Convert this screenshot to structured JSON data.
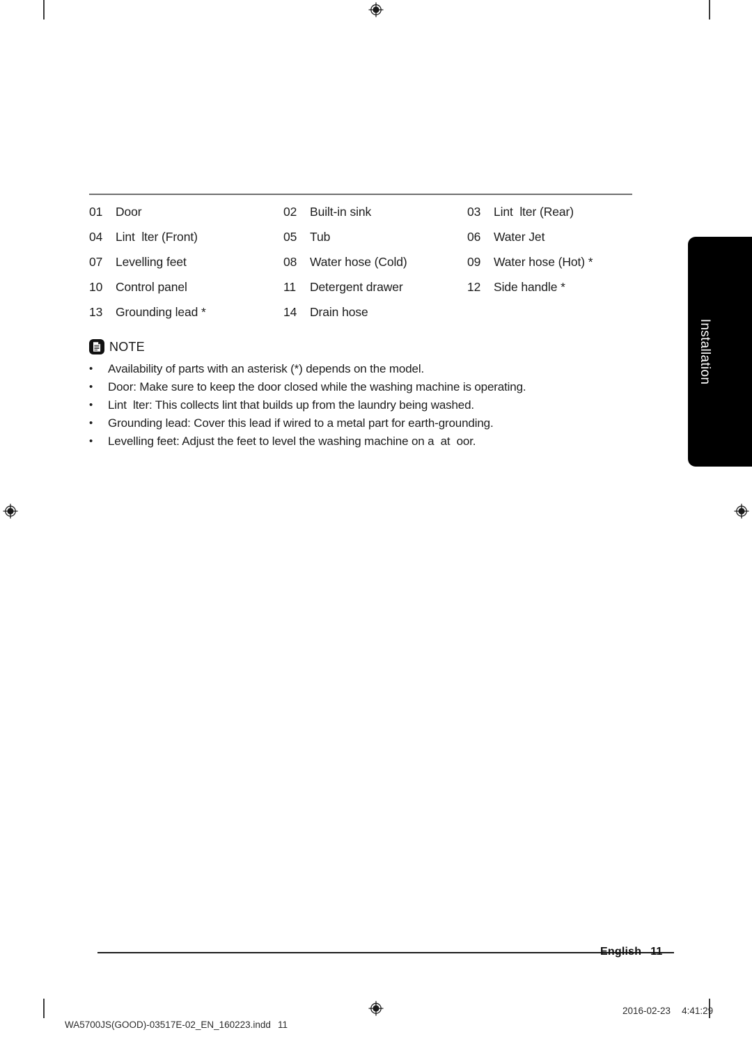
{
  "document": {
    "chapter_tab": "Installation",
    "page_footer": {
      "language": "English",
      "page_number": "11"
    },
    "print_footer": {
      "filename": "WA5700JS(GOOD)-03517E-02_EN_160223.indd",
      "page": "11",
      "date": "2016-02-23",
      "time": "4:41:29"
    }
  },
  "parts_list": {
    "rows": [
      [
        {
          "num": "01",
          "label": "Door"
        },
        {
          "num": "02",
          "label": "Built-in sink"
        },
        {
          "num": "03",
          "label": "Lint  lter (Rear)"
        }
      ],
      [
        {
          "num": "04",
          "label": "Lint  lter (Front)"
        },
        {
          "num": "05",
          "label": "Tub"
        },
        {
          "num": "06",
          "label": "Water Jet"
        }
      ],
      [
        {
          "num": "07",
          "label": "Levelling feet"
        },
        {
          "num": "08",
          "label": "Water hose (Cold)"
        },
        {
          "num": "09",
          "label": "Water hose (Hot) *"
        }
      ],
      [
        {
          "num": "10",
          "label": "Control panel"
        },
        {
          "num": "11",
          "label": "Detergent drawer"
        },
        {
          "num": "12",
          "label": "Side handle *"
        }
      ],
      [
        {
          "num": "13",
          "label": "Grounding lead *"
        },
        {
          "num": "14",
          "label": "Drain hose"
        },
        {
          "num": "",
          "label": ""
        }
      ]
    ]
  },
  "note": {
    "icon": "document-note-icon",
    "title": "NOTE",
    "bullet": "•",
    "items": [
      "Availability of parts with an asterisk (*) depends on the model.",
      "Door: Make sure to keep the door closed while the washing machine is operating.",
      "Lint  lter: This collects lint that builds up from the laundry being washed.",
      "Grounding lead: Cover this lead if wired to a metal part for earth-grounding.",
      "Levelling feet: Adjust the feet to level the washing machine on a  at  oor."
    ]
  }
}
